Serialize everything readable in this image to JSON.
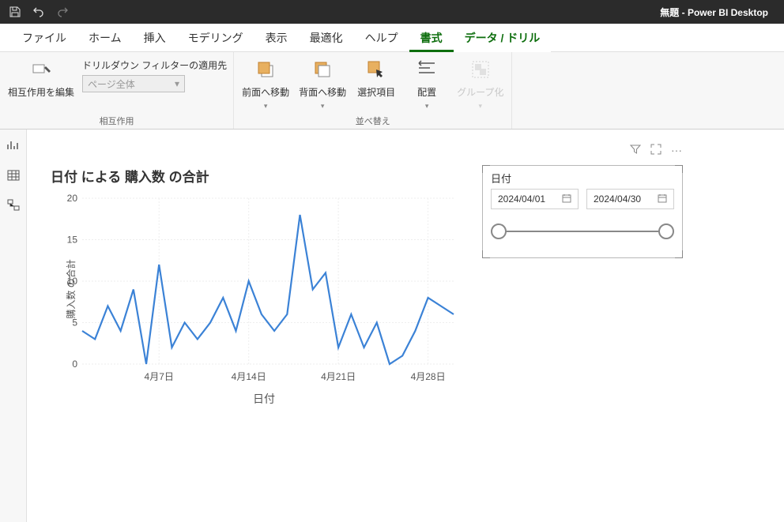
{
  "titlebar": {
    "title": "無題 - Power BI Desktop"
  },
  "menu": {
    "file": "ファイル",
    "home": "ホーム",
    "insert": "挿入",
    "modeling": "モデリング",
    "view": "表示",
    "optimize": "最適化",
    "help": "ヘルプ",
    "format": "書式",
    "data_drill": "データ / ドリル"
  },
  "ribbon": {
    "edit_interactions": "相互作用を編集",
    "drill_filter_label": "ドリルダウン フィルターの適用先",
    "drill_filter_value": "ページ全体",
    "group_interactions": "相互作用",
    "bring_forward": "前面へ移動",
    "send_backward": "背面へ移動",
    "selection": "選択項目",
    "align": "配置",
    "group": "グループ化",
    "group_arrange": "並べ替え"
  },
  "chart": {
    "title": "日付 による 購入数 の合計",
    "y_axis_label": "購入数 の合計",
    "x_axis_label": "日付",
    "x_ticks": [
      "4月7日",
      "4月14日",
      "4月21日",
      "4月28日"
    ],
    "y_ticks": [
      "0",
      "5",
      "10",
      "15",
      "20"
    ]
  },
  "slicer": {
    "title": "日付",
    "date_from": "2024/04/01",
    "date_to": "2024/04/30"
  },
  "chart_data": {
    "type": "line",
    "title": "日付 による 購入数 の合計",
    "xlabel": "日付",
    "ylabel": "購入数 の合計",
    "ylim": [
      0,
      20
    ],
    "x": [
      "4/1",
      "4/2",
      "4/3",
      "4/4",
      "4/5",
      "4/6",
      "4/7",
      "4/8",
      "4/9",
      "4/10",
      "4/11",
      "4/12",
      "4/13",
      "4/14",
      "4/15",
      "4/16",
      "4/17",
      "4/18",
      "4/19",
      "4/20",
      "4/21",
      "4/22",
      "4/23",
      "4/24",
      "4/25",
      "4/26",
      "4/27",
      "4/28",
      "4/29",
      "4/30"
    ],
    "values": [
      4,
      3,
      7,
      4,
      9,
      0,
      12,
      2,
      5,
      3,
      5,
      8,
      4,
      10,
      6,
      4,
      6,
      18,
      9,
      11,
      2,
      6,
      2,
      5,
      0,
      1,
      4,
      8,
      7,
      6
    ],
    "x_tick_labels": [
      "4月7日",
      "4月14日",
      "4月21日",
      "4月28日"
    ]
  }
}
